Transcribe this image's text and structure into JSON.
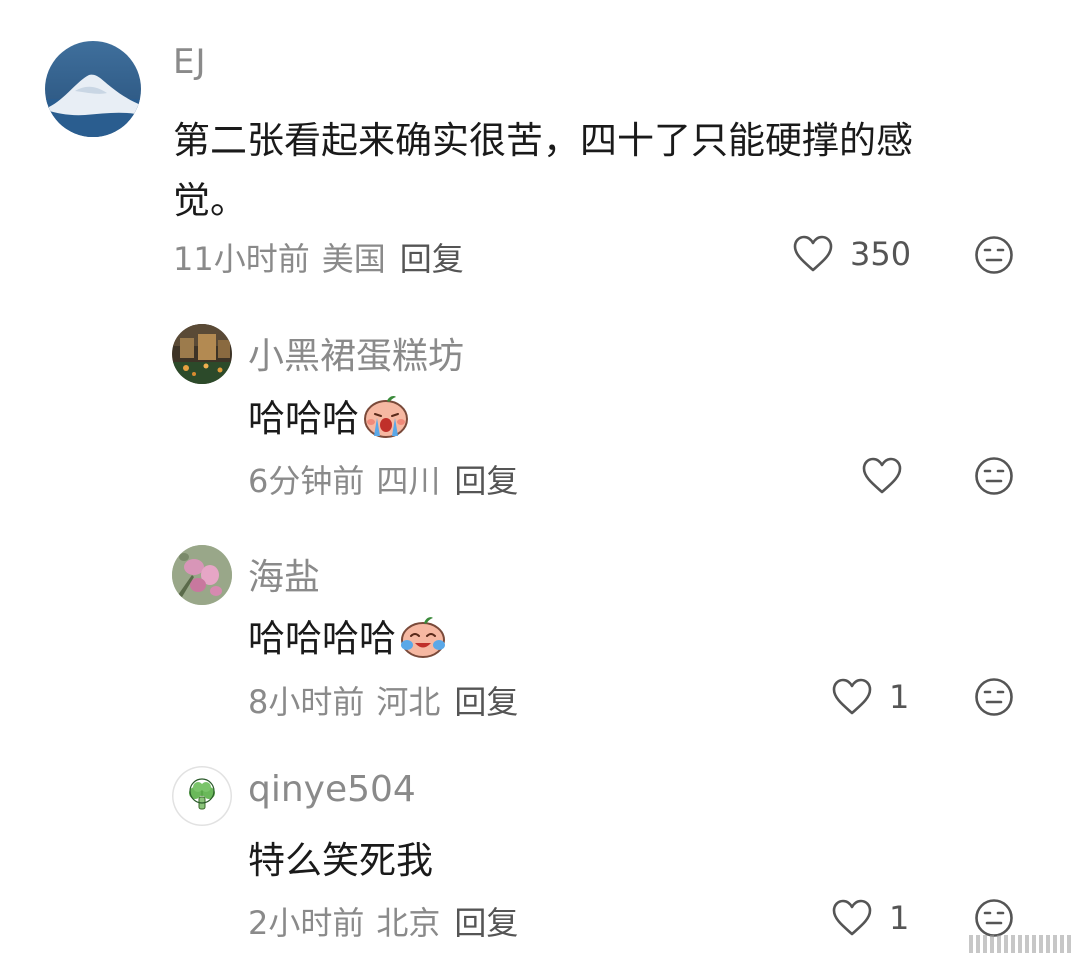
{
  "comments": [
    {
      "username": "EJ",
      "text_line1": "第二张看起来确实很苦，四十了只能硬撑的感",
      "text_line2": "觉。",
      "time": "11小时前",
      "location": "美国",
      "reply_label": "回复",
      "likes": "350"
    },
    {
      "username": "小黑裙蛋糕坊",
      "text": "哈哈哈",
      "time": "6分钟前",
      "location": "四川",
      "reply_label": "回复",
      "likes": ""
    },
    {
      "username": "海盐",
      "text": "哈哈哈哈",
      "time": "8小时前",
      "location": "河北",
      "reply_label": "回复",
      "likes": "1"
    },
    {
      "username": "qinye504",
      "text": "特么笑死我",
      "time": "2小时前",
      "location": "北京",
      "reply_label": "回复",
      "likes": "1"
    }
  ],
  "icons": {
    "like": "heart-outline-icon",
    "dislike": "neutral-face-icon",
    "emoji_cry": "crying-peach-emoji",
    "emoji_laugh": "laughing-peach-emoji"
  },
  "colors": {
    "text": "#1a1a1a",
    "meta": "#8a8a8a",
    "reply": "#555555",
    "icon": "#555555"
  }
}
